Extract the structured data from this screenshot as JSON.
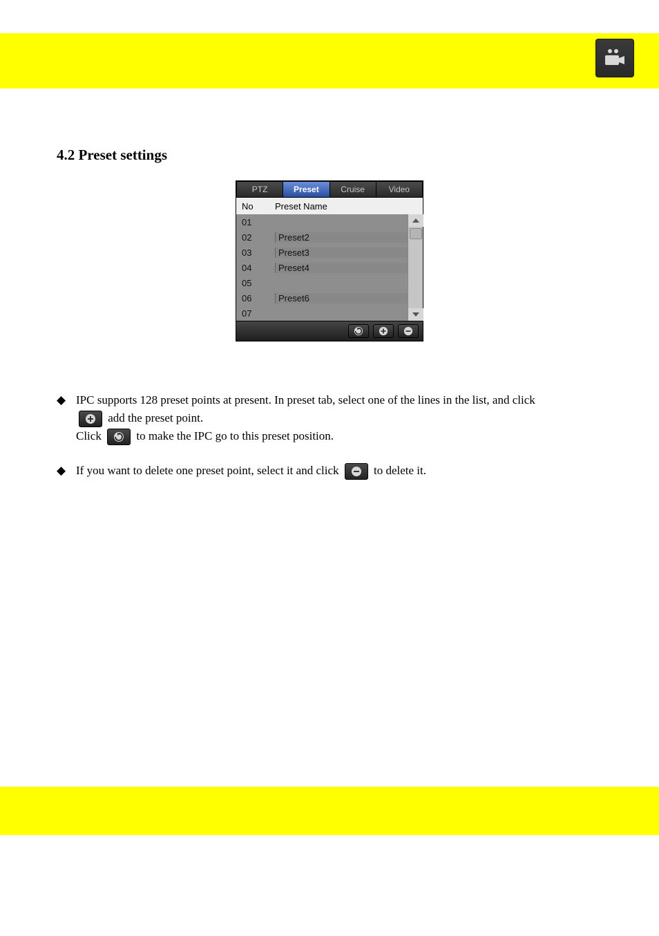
{
  "section_title": "4.2 Preset settings",
  "panel": {
    "tabs": {
      "ptz": "PTZ",
      "preset": "Preset",
      "cruise": "Cruise",
      "video": "Video"
    },
    "header": {
      "no": "No",
      "name": "Preset Name"
    },
    "rows": [
      {
        "no": "01",
        "name": ""
      },
      {
        "no": "02",
        "name": "Preset2"
      },
      {
        "no": "03",
        "name": "Preset3"
      },
      {
        "no": "04",
        "name": "Preset4"
      },
      {
        "no": "05",
        "name": ""
      },
      {
        "no": "06",
        "name": "Preset6"
      },
      {
        "no": "07",
        "name": ""
      }
    ]
  },
  "bullets": {
    "b1": "IPC supports 128 preset points at present. In preset tab, select one of the lines in the list, and click ",
    "b1b": " add the preset point. ",
    "b2": "Click ",
    "b2b": " to make the IPC go to this preset position. ",
    "b3a": "If you want to delete one preset point, select it and click ",
    "b3b": " to delete it. "
  }
}
